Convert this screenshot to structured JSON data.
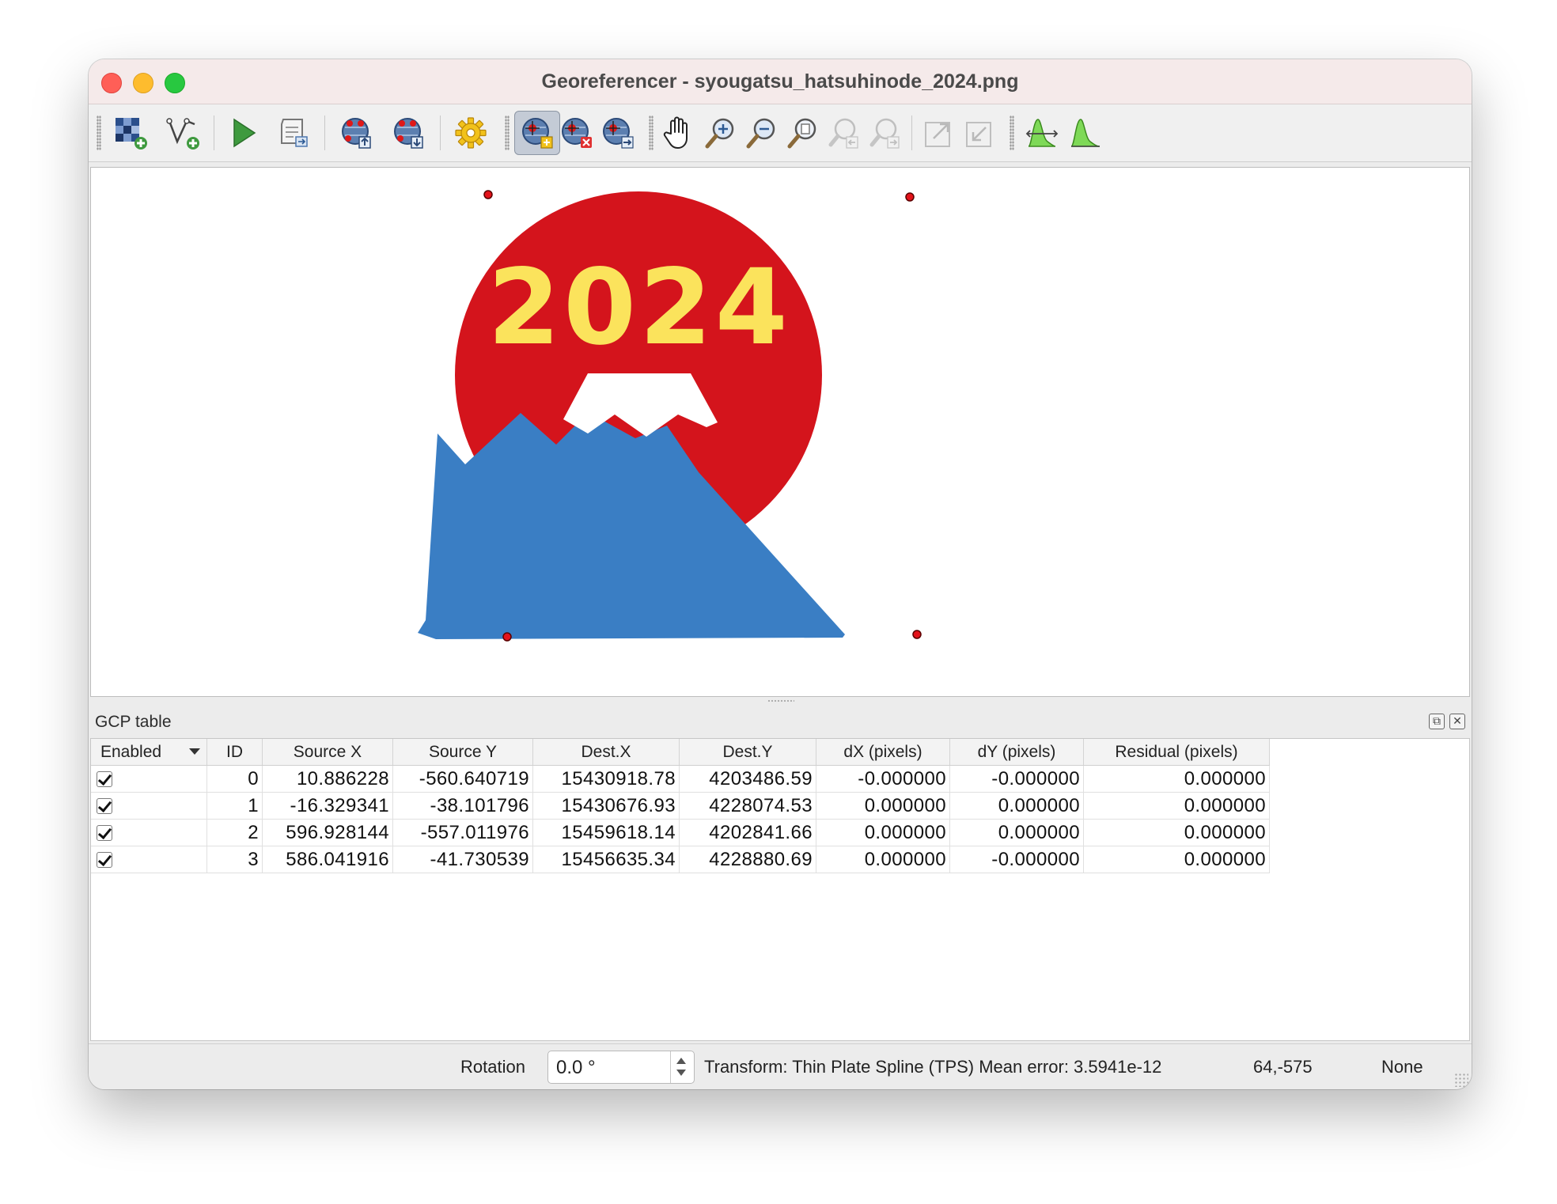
{
  "window": {
    "title": "Georeferencer - syougatsu_hatsuhinode_2024.png"
  },
  "toolbar": {
    "buttons": [
      {
        "name": "open-raster-button",
        "icon": "raster-add-icon"
      },
      {
        "name": "start-georeferencing-button",
        "icon": "vector-add-icon"
      },
      {
        "name": "run-button",
        "icon": "play-icon"
      },
      {
        "name": "generate-script-button",
        "icon": "script-icon"
      },
      {
        "name": "load-gcp-button",
        "icon": "gcp-load-icon"
      },
      {
        "name": "save-gcp-button",
        "icon": "gcp-save-icon"
      },
      {
        "name": "transformation-settings-button",
        "icon": "gear-icon"
      },
      {
        "name": "add-point-button",
        "icon": "add-point-icon",
        "active": true
      },
      {
        "name": "delete-point-button",
        "icon": "delete-point-icon"
      },
      {
        "name": "move-point-button",
        "icon": "move-point-icon"
      },
      {
        "name": "pan-button",
        "icon": "hand-icon"
      },
      {
        "name": "zoom-in-button",
        "icon": "zoom-in-icon"
      },
      {
        "name": "zoom-out-button",
        "icon": "zoom-out-icon"
      },
      {
        "name": "zoom-to-layer-button",
        "icon": "zoom-layer-icon"
      },
      {
        "name": "zoom-last-button",
        "icon": "zoom-last-icon"
      },
      {
        "name": "zoom-next-button",
        "icon": "zoom-next-icon"
      },
      {
        "name": "link-georef-button",
        "icon": "link-georef-icon"
      },
      {
        "name": "link-qgis-button",
        "icon": "link-qgis-icon"
      },
      {
        "name": "histogram-stretch-button",
        "icon": "histogram-stretch-icon"
      },
      {
        "name": "histogram-cumulative-button",
        "icon": "histogram-icon"
      }
    ]
  },
  "canvas": {
    "image_text": "2024",
    "colors": {
      "sun": "#d4141c",
      "mountain": "#3a7ec4",
      "snow": "#ffffff",
      "year_text": "#fbe35c",
      "gcp_marker": "#e3121a"
    }
  },
  "gcp_panel": {
    "title": "GCP table",
    "columns": [
      "Enabled",
      "ID",
      "Source X",
      "Source Y",
      "Dest.X",
      "Dest.Y",
      "dX (pixels)",
      "dY (pixels)",
      "Residual (pixels)"
    ],
    "rows": [
      {
        "enabled": true,
        "id": "0",
        "source_x": "10.886228",
        "source_y": "-560.640719",
        "dest_x": "15430918.78",
        "dest_y": "4203486.59",
        "dx": "-0.000000",
        "dy": "-0.000000",
        "residual": "0.000000"
      },
      {
        "enabled": true,
        "id": "1",
        "source_x": "-16.329341",
        "source_y": "-38.101796",
        "dest_x": "15430676.93",
        "dest_y": "4228074.53",
        "dx": "0.000000",
        "dy": "0.000000",
        "residual": "0.000000"
      },
      {
        "enabled": true,
        "id": "2",
        "source_x": "596.928144",
        "source_y": "-557.011976",
        "dest_x": "15459618.14",
        "dest_y": "4202841.66",
        "dx": "0.000000",
        "dy": "0.000000",
        "residual": "0.000000"
      },
      {
        "enabled": true,
        "id": "3",
        "source_x": "586.041916",
        "source_y": "-41.730539",
        "dest_x": "15456635.34",
        "dest_y": "4228880.69",
        "dx": "0.000000",
        "dy": "-0.000000",
        "residual": "0.000000"
      }
    ]
  },
  "statusbar": {
    "rotation_label": "Rotation",
    "rotation_value": "0.0 °",
    "transform_text": "Transform: Thin Plate Spline (TPS) Mean error: 3.5941e-12",
    "coordinates": "64,-575",
    "crs": "None"
  }
}
